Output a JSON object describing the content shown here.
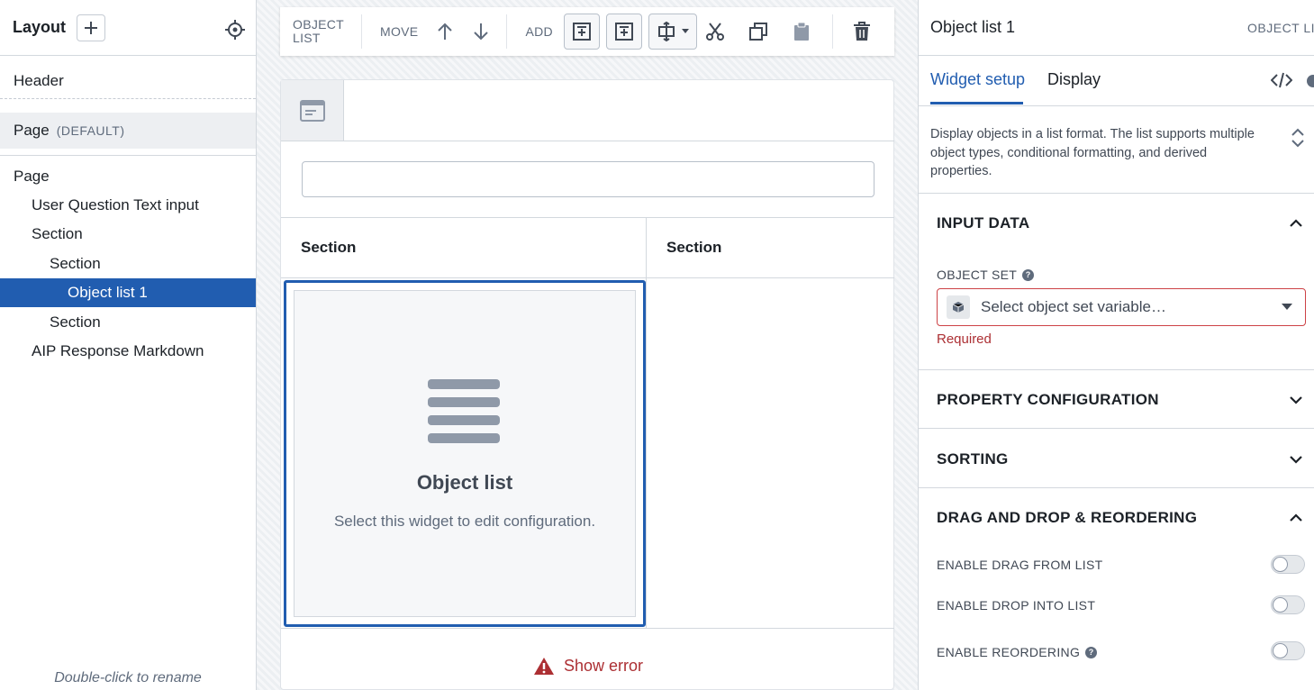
{
  "left": {
    "title": "Layout",
    "tree": {
      "header": "Header",
      "page_default": {
        "label": "Page",
        "tag": "(DEFAULT)"
      },
      "items": [
        {
          "label": "Page",
          "indent": 0
        },
        {
          "label": "User Question Text input",
          "indent": 1
        },
        {
          "label": "Section",
          "indent": 1
        },
        {
          "label": "Section",
          "indent": 2
        },
        {
          "label": "Object list 1",
          "indent": 3,
          "selected": true
        },
        {
          "label": "Section",
          "indent": 2
        },
        {
          "label": "AIP Response Markdown",
          "indent": 1
        }
      ]
    },
    "footer": "Double-click to rename"
  },
  "toolbar": {
    "context_line1": "OBJECT",
    "context_line2": "LIST",
    "move_label": "MOVE",
    "add_label": "ADD"
  },
  "canvas": {
    "section_left": "Section",
    "section_right": "Section",
    "widget_title": "Object list",
    "widget_subtitle": "Select this widget to edit configuration.",
    "error_label": "Show error"
  },
  "right": {
    "title": "Object list 1",
    "type_label": "OBJECT LIST",
    "tabs": {
      "setup": "Widget setup",
      "display": "Display"
    },
    "description": "Display objects in a list format. The list supports multiple object types, conditional formatting, and derived properties.",
    "sections": {
      "input_data": "INPUT DATA",
      "property_config": "PROPERTY CONFIGURATION",
      "sorting": "SORTING",
      "dnd": "DRAG AND DROP & REORDERING"
    },
    "object_set": {
      "label": "OBJECT SET",
      "placeholder": "Select object set variable…",
      "error": "Required"
    },
    "toggles": {
      "drag_from": "ENABLE DRAG FROM LIST",
      "drop_into": "ENABLE DROP INTO LIST",
      "reorder": "ENABLE REORDERING"
    }
  },
  "colors": {
    "accent": "#215db0",
    "error": "#ac2f33"
  }
}
